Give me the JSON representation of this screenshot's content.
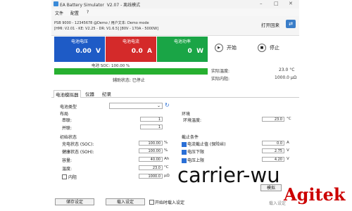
{
  "window": {
    "title": "EA Battery Simulator",
    "version": "V2.07",
    "subtitle": "离线模式",
    "minimize": "–",
    "maximize": "□",
    "close": "✕"
  },
  "menu": [
    "文件",
    "配置",
    "?"
  ],
  "info": {
    "line1": "PSB 9000 - 12345678 @Demo / 用户文本: Demo mode",
    "line2": "[HMI: V2.01 - KE: V2.25 - DR: V1.6.5] [80V - 170A - 5000W]",
    "remote_label": "打开回来"
  },
  "panels": {
    "voltage": {
      "title": "电池电压",
      "value": "0.00",
      "unit": "V",
      "color": "#1e5bc6"
    },
    "current": {
      "title": "电池电流",
      "value": "0.0",
      "unit": "A",
      "color": "#d42a2a"
    },
    "power": {
      "title": "电池功率",
      "value": "0",
      "unit": "W",
      "color": "#1aa546"
    }
  },
  "controls": {
    "start": "开始",
    "stop": "停止"
  },
  "soc": {
    "label": "电池 SOC: 100.00 %",
    "percent": 100
  },
  "state": {
    "label": "辅助状态: 已停止"
  },
  "measurements": {
    "temp_label": "实际温度:",
    "temp_value": "23.0 °C",
    "resist_label": "实际内阻:",
    "resist_value": "1000.0 µΩ"
  },
  "tabs": [
    "电池模拟器",
    "仪器",
    "纪录"
  ],
  "settings": {
    "battery_type_label": "电池类型",
    "battery_type_value": "",
    "layout_title": "布局",
    "series_label": "串联:",
    "series_value": "1",
    "parallel_label": "并联:",
    "parallel_value": "1",
    "init_title": "初始状态",
    "rows": [
      {
        "label": "充电状态 (SOC):",
        "value": "100.00",
        "unit": "%"
      },
      {
        "label": "健康状态 (SOH):",
        "value": "100.00",
        "unit": "%"
      },
      {
        "label": "容量:",
        "value": "40.00",
        "unit": "Ah"
      },
      {
        "label": "温度:",
        "value": "23.0",
        "unit": "°C"
      },
      {
        "label": "内阻",
        "value": "1000.0",
        "unit": "µΩ"
      }
    ],
    "env_title": "环境",
    "env_label": "环境温度:",
    "env_value": "23.0",
    "env_unit": "°C",
    "stop_title": "截止条件",
    "stop_rows": [
      {
        "label": "电流截止值 (保险丝)",
        "value": "0.0",
        "unit": "A",
        "checked": true
      },
      {
        "label": "电压下限",
        "value": "2.75",
        "unit": "V",
        "checked": true
      },
      {
        "label": "电压上限",
        "value": "4.20",
        "unit": "V",
        "checked": true
      }
    ]
  },
  "bottom": {
    "save": "储存设定",
    "load": "载入设定",
    "autoload": "开始时载入设定",
    "simulate": "模拟"
  },
  "overlay": {
    "text": "carrier-wu",
    "logo": "Agitek",
    "faint": "载入设定"
  }
}
